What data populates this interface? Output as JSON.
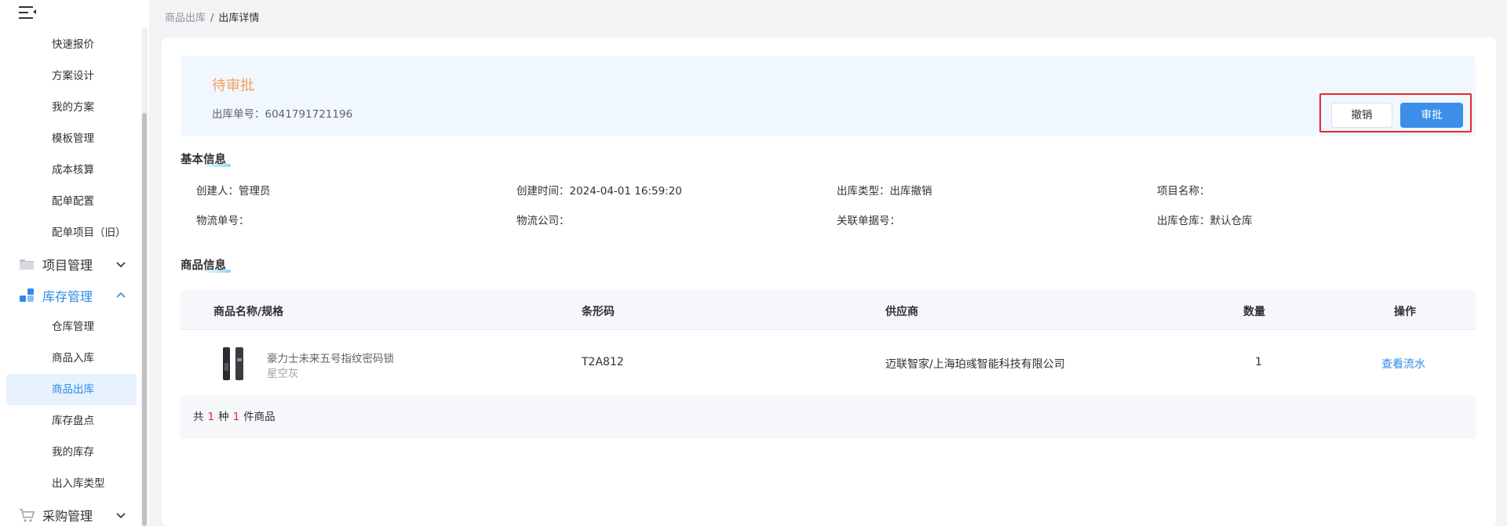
{
  "breadcrumb": {
    "parent": "商品出库",
    "separator": "/",
    "current": "出库详情"
  },
  "sidebar": {
    "top_items": [
      "快速报价",
      "方案设计",
      "我的方案",
      "模板管理",
      "成本核算",
      "配单配置",
      "配单项目（旧）"
    ],
    "groups": {
      "project": {
        "label": "项目管理"
      },
      "inventory": {
        "label": "库存管理"
      },
      "purchase": {
        "label": "采购管理"
      }
    },
    "inventory_items": [
      "仓库管理",
      "商品入库",
      "商品出库",
      "库存盘点",
      "我的库存",
      "出入库类型"
    ],
    "active_item": "商品出库",
    "accent_color": "#2a8ce8"
  },
  "status": {
    "title": "待审批",
    "order_no_label": "出库单号：",
    "order_no": "6041791721196",
    "title_color": "#f4a15d"
  },
  "actions": {
    "cancel": "撤销",
    "approve": "审批"
  },
  "basic_info": {
    "title": "基本信息",
    "fields": [
      {
        "label": "创建人：",
        "value": "管理员"
      },
      {
        "label": "创建时间：",
        "value": "2024-04-01 16:59:20"
      },
      {
        "label": "出库类型：",
        "value": "出库撤销"
      },
      {
        "label": "项目名称：",
        "value": ""
      },
      {
        "label": "物流单号：",
        "value": ""
      },
      {
        "label": "物流公司：",
        "value": ""
      },
      {
        "label": "关联单据号：",
        "value": ""
      },
      {
        "label": "出库仓库：",
        "value": "默认仓库"
      }
    ]
  },
  "goods": {
    "title": "商品信息",
    "columns": [
      "商品名称/规格",
      "条形码",
      "供应商",
      "数量",
      "操作"
    ],
    "rows": [
      {
        "name": "豪力士未来五号指纹密码锁",
        "spec": "星空灰",
        "barcode": "T2A812",
        "supplier": "迈联智家/上海珀彧智能科技有限公司",
        "quantity": "1",
        "action": "查看流水"
      }
    ],
    "footer": {
      "prefix": "共",
      "kinds": "1",
      "mid": "种",
      "count": "1",
      "suffix": "件商品"
    }
  }
}
